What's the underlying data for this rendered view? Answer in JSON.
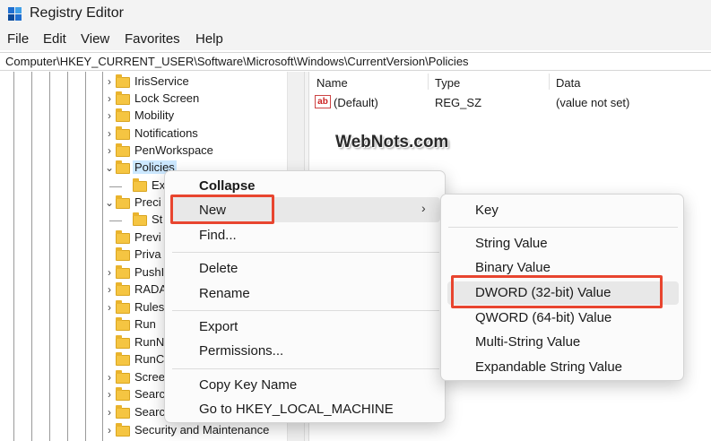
{
  "window": {
    "title": "Registry Editor"
  },
  "menu": [
    "File",
    "Edit",
    "View",
    "Favorites",
    "Help"
  ],
  "address": "Computer\\HKEY_CURRENT_USER\\Software\\Microsoft\\Windows\\CurrentVersion\\Policies",
  "tree": {
    "items": [
      {
        "label": "IrisService",
        "chevron": "›"
      },
      {
        "label": "Lock Screen",
        "chevron": "›"
      },
      {
        "label": "Mobility",
        "chevron": "›"
      },
      {
        "label": "Notifications",
        "chevron": "›"
      },
      {
        "label": "PenWorkspace",
        "chevron": "›"
      },
      {
        "label": "Policies",
        "chevron": "⌄"
      },
      {
        "label": "Ex",
        "chevron": ""
      },
      {
        "label": "Preci",
        "chevron": "⌄"
      },
      {
        "label": "St",
        "chevron": ""
      },
      {
        "label": "Previ",
        "chevron": ""
      },
      {
        "label": "Priva",
        "chevron": ""
      },
      {
        "label": "PushI",
        "chevron": "›"
      },
      {
        "label": "RADA",
        "chevron": "›"
      },
      {
        "label": "Rules",
        "chevron": "›"
      },
      {
        "label": "Run",
        "chevron": ""
      },
      {
        "label": "RunN",
        "chevron": ""
      },
      {
        "label": "RunC",
        "chevron": ""
      },
      {
        "label": "Scree",
        "chevron": "›"
      },
      {
        "label": "Searc",
        "chevron": "›"
      },
      {
        "label": "Searc",
        "chevron": "›"
      },
      {
        "label": "Security and Maintenance",
        "chevron": "›"
      }
    ]
  },
  "values_pane": {
    "columns": [
      "Name",
      "Type",
      "Data"
    ],
    "rows": [
      {
        "name": "(Default)",
        "type": "REG_SZ",
        "data": "(value not set)",
        "icon": "ab"
      }
    ]
  },
  "watermark": "WebNots.com",
  "context_menu": {
    "collapse": "Collapse",
    "new": "New",
    "new_arrow": "›",
    "find": "Find...",
    "delete": "Delete",
    "rename": "Rename",
    "export": "Export",
    "permissions": "Permissions...",
    "copy_key_name": "Copy Key Name",
    "goto": "Go to HKEY_LOCAL_MACHINE"
  },
  "submenu": {
    "key": "Key",
    "string_value": "String Value",
    "binary_value": "Binary Value",
    "dword_value": "DWORD (32-bit) Value",
    "qword_value": "QWORD (64-bit) Value",
    "multi_string_value": "Multi-String Value",
    "expandable_string_value": "Expandable String Value"
  },
  "colors": {
    "highlight_box": "#e8452f",
    "selection": "#cce8ff",
    "folder": "#f5c542"
  }
}
